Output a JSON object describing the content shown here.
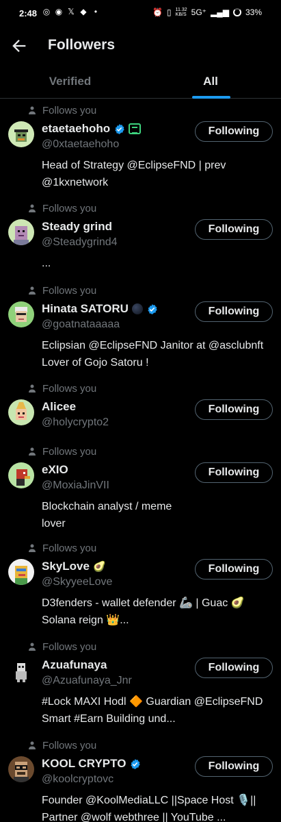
{
  "status_bar": {
    "time": "2:48",
    "network_speed": "11.32\nKB/S",
    "network": "5G⁺",
    "battery": "33%"
  },
  "header": {
    "title": "Followers"
  },
  "tabs": [
    {
      "label": "Verified"
    },
    {
      "label": "All"
    }
  ],
  "follows_you_label": "Follows you",
  "button_label": "Following",
  "followers": [
    {
      "name": "etaetaehoho",
      "handle": "@0xtaetaehoho",
      "verified": true,
      "badge": "eclipse",
      "bio": "Head of Strategy @EclipseFND | prev @1kxnetwork"
    },
    {
      "name": "Steady grind",
      "handle": "@Steadygrind4",
      "verified": false,
      "bio": "..."
    },
    {
      "name": "Hinata SATORU",
      "handle": "@goatnataaaaa",
      "verified": true,
      "badge": "moon",
      "bio": "Eclipsian @EclipseFND Janitor at @asclubnft Lover of Gojo Satoru !"
    },
    {
      "name": "Alicee",
      "handle": "@holycrypto2",
      "verified": false,
      "bio": ""
    },
    {
      "name": "eXIO",
      "handle": "@MoxiaJinVII",
      "verified": false,
      "bio": "Blockchain analyst / meme lover"
    },
    {
      "name": "SkyLove",
      "name_emoji": "🥑",
      "handle": "@SkyyeeLove",
      "verified": false,
      "bio": "D3fenders - wallet defender 🦾 | Guac 🥑 Solana reign 👑..."
    },
    {
      "name": "Azuafunaya",
      "handle": "@Azuafunaya_Jnr",
      "verified": false,
      "bio": "#Lock MAXI  Hodl 🔶 Guardian @EclipseFND Smart #Earn Building und..."
    },
    {
      "name": "KOOL CRYPTO",
      "handle": "@koolcryptovc",
      "verified": true,
      "bio": "Founder @KoolMediaLLC ||Space Host 🎙️|| Partner @wolf webthree || YouTube ..."
    }
  ],
  "colors": {
    "accent": "#1d9bf0",
    "background": "#000000",
    "secondary_text": "#71767b"
  }
}
